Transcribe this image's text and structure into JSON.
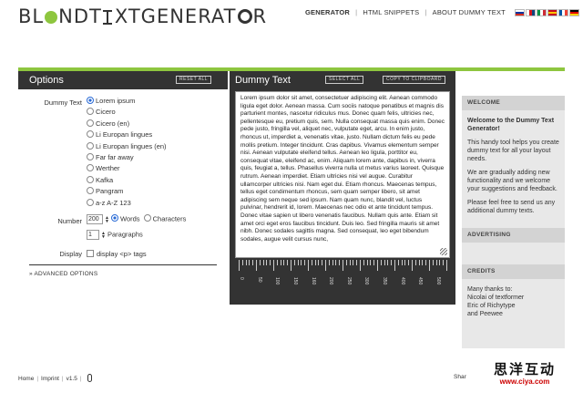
{
  "logo": {
    "part1": "BL",
    "part2": "NDT",
    "part3": "XTGENERAT",
    "part4": "R"
  },
  "nav": {
    "items": [
      "GENERATOR",
      "HTML SNIPPETS",
      "ABOUT DUMMY TEXT"
    ],
    "separator": "|",
    "flags": [
      {
        "name": "russian-flag-icon",
        "colors": [
          "#ffffff",
          "#0033a0",
          "#d52b1e"
        ]
      },
      {
        "name": "czech-flag-icon",
        "colors": [
          "#ffffff",
          "#d7141a",
          "#11457e"
        ]
      },
      {
        "name": "italian-flag-icon",
        "colors": [
          "#009246",
          "#ffffff",
          "#ce2b37"
        ]
      },
      {
        "name": "spanish-flag-icon",
        "colors": [
          "#c60b1e",
          "#ffc400",
          "#c60b1e"
        ]
      },
      {
        "name": "french-flag-icon",
        "colors": [
          "#0055a4",
          "#ffffff",
          "#ef4135"
        ]
      },
      {
        "name": "german-flag-icon",
        "colors": [
          "#000000",
          "#dd0000",
          "#ffce00"
        ]
      }
    ]
  },
  "colors": {
    "accent": "#8ec63f",
    "dark": "#333333",
    "sidebar": "#e8e8e8",
    "watermark_url": "#cc0000"
  },
  "options": {
    "title": "Options",
    "reset_label": "RESET ALL",
    "dummy_text_label": "Dummy Text",
    "dummy_text_options": [
      "Lorem ipsum",
      "Cicero",
      "Cicero (en)",
      "Li Europan lingues",
      "Li Europan lingues (en)",
      "Far far away",
      "Werther",
      "Kafka",
      "Pangram",
      "a-z A-Z 123"
    ],
    "selected_index": 0,
    "number_label": "Number",
    "number_value": "200",
    "unit_words": "Words",
    "unit_characters": "Characters",
    "paragraphs_value": "1",
    "paragraphs_label": "Paragraphs",
    "display_label": "Display",
    "display_p_tags": "display <p> tags",
    "advanced_label": "» ADVANCED OPTIONS"
  },
  "dummy": {
    "title": "Dummy Text",
    "select_all": "SELECT ALL",
    "copy": "COPY TO CLIPBOARD",
    "text": "Lorem ipsum dolor sit amet, consectetuer adipiscing elit. Aenean commodo ligula eget dolor. Aenean massa. Cum sociis natoque penatibus et magnis dis parturient montes, nascetur ridiculus mus. Donec quam felis, ultricies nec, pellentesque eu, pretium quis, sem. Nulla consequat massa quis enim. Donec pede justo, fringilla vel, aliquet nec, vulputate eget, arcu. In enim justo, rhoncus ut, imperdiet a, venenatis vitae, justo. Nullam dictum felis eu pede mollis pretium. Integer tincidunt. Cras dapibus. Vivamus elementum semper nisi. Aenean vulputate eleifend tellus. Aenean leo ligula, porttitor eu, consequat vitae, eleifend ac, enim. Aliquam lorem ante, dapibus in, viverra quis, feugiat a, tellus. Phasellus viverra nulla ut metus varius laoreet. Quisque rutrum. Aenean imperdiet. Etiam ultricies nisi vel augue. Curabitur ullamcorper ultricies nisi. Nam eget dui. Etiam rhoncus. Maecenas tempus, tellus eget condimentum rhoncus, sem quam semper libero, sit amet adipiscing sem neque sed ipsum. Nam quam nunc, blandit vel, luctus pulvinar, hendrerit id, lorem. Maecenas nec odio et ante tincidunt tempus. Donec vitae sapien ut libero venenatis faucibus. Nullam quis ante. Etiam sit amet orci eget eros faucibus tincidunt. Duis leo. Sed fringilla mauris sit amet nibh. Donec sodales sagittis magna. Sed consequat, leo eget bibendum sodales, augue velit cursus nunc,",
    "ruler_labels": [
      "0",
      "50",
      "100",
      "150",
      "160",
      "200",
      "250",
      "300",
      "350",
      "400",
      "450",
      "500"
    ]
  },
  "sidebar": {
    "welcome_head": "WELCOME",
    "welcome_title": "Welcome to the Dummy Text Generator!",
    "welcome_p1": "This handy tool helps you create dummy text for all your layout needs.",
    "welcome_p2": "We are gradually adding new functionality and we welcome your suggestions and feedback.",
    "welcome_p3": "Please feel free to send us any additional dummy texts.",
    "advertising_head": "ADVERTISING",
    "credits_head": "CREDITS",
    "credits_intro": "Many thanks to:",
    "credits_1": "Nicolai of textformer",
    "credits_2": "Eric of Richytype",
    "credits_3": "and Peewee"
  },
  "footer": {
    "home": "Home",
    "imprint": "Imprint",
    "version": "v1.5",
    "share": "Shar"
  },
  "watermark": {
    "chinese": "思洋互动",
    "url": "www.ciya.com"
  }
}
